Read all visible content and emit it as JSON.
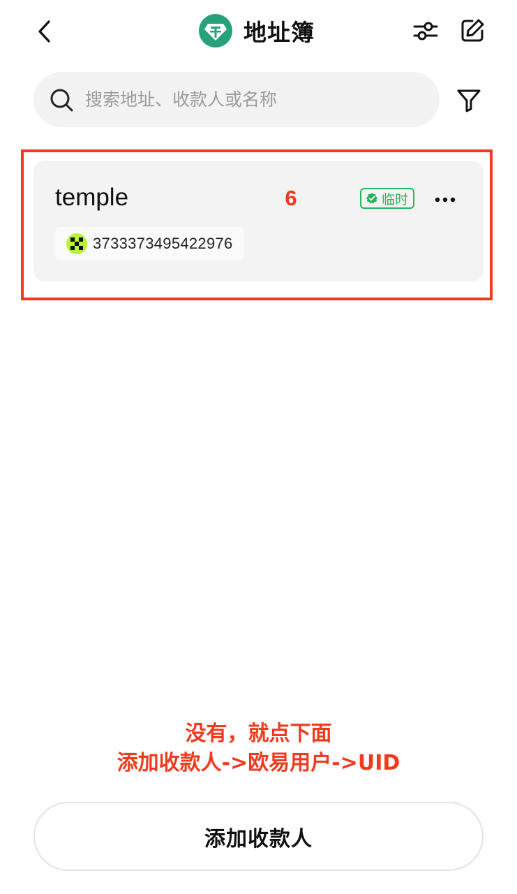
{
  "header": {
    "title": "地址簿",
    "back_icon": "chevron-left-icon",
    "token_icon": "tether-usdt-icon",
    "token_color": "#26a17b",
    "settings_icon": "sliders-icon",
    "edit_icon": "edit-icon"
  },
  "search": {
    "placeholder": "搜索地址、收款人或名称",
    "value": "",
    "icon": "search-icon",
    "filter_icon": "filter-icon"
  },
  "contacts": [
    {
      "name": "temple",
      "badge": "临时",
      "badge_color": "#25b35b",
      "uid": "3733373495422976",
      "exchange_icon": "okx-icon",
      "menu_icon": "more-icon"
    }
  ],
  "annotation": {
    "number": "6",
    "note_line1": "没有，就点下面",
    "note_line2": "添加收款人->欧易用户->UID",
    "color": "#ee3a1f"
  },
  "footer": {
    "add_button_label": "添加收款人"
  }
}
